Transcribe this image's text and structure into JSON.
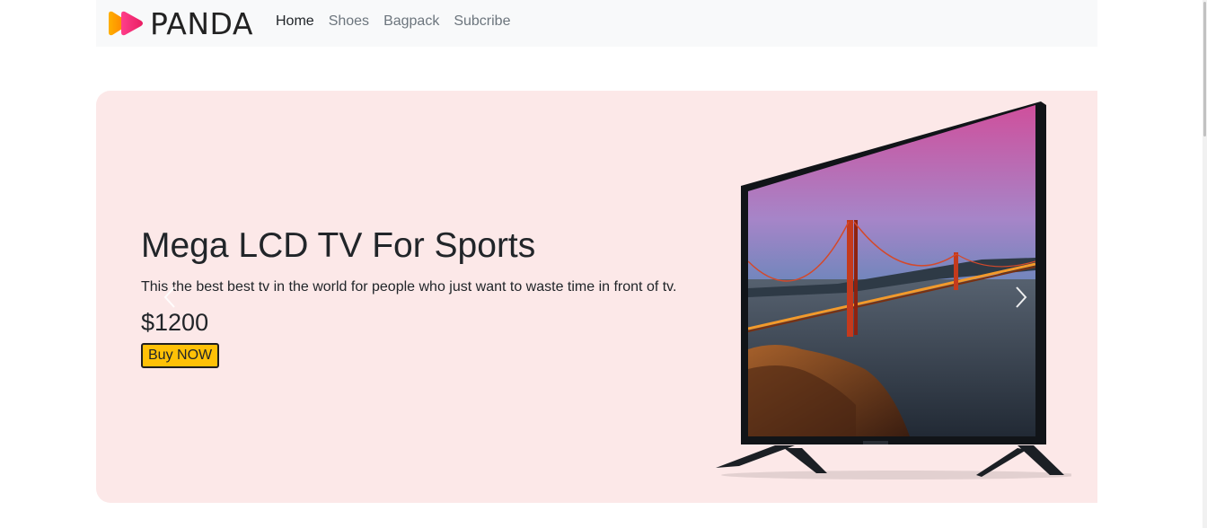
{
  "navbar": {
    "brand": "PANDA",
    "links": [
      {
        "label": "Home",
        "active": true
      },
      {
        "label": "Shoes",
        "active": false
      },
      {
        "label": "Bagpack",
        "active": false
      },
      {
        "label": "Subcribe",
        "active": false
      }
    ]
  },
  "hero": {
    "title": "Mega LCD TV For Sports",
    "description": "This the best best tv in the world for people who just want to waste time in front of tv.",
    "price": "$1200",
    "button_label": "Buy NOW",
    "background_color": "#fce8e8",
    "button_color": "#ffc107"
  },
  "controls": {
    "prev_icon": "chevron-left-icon",
    "next_icon": "chevron-right-icon"
  }
}
